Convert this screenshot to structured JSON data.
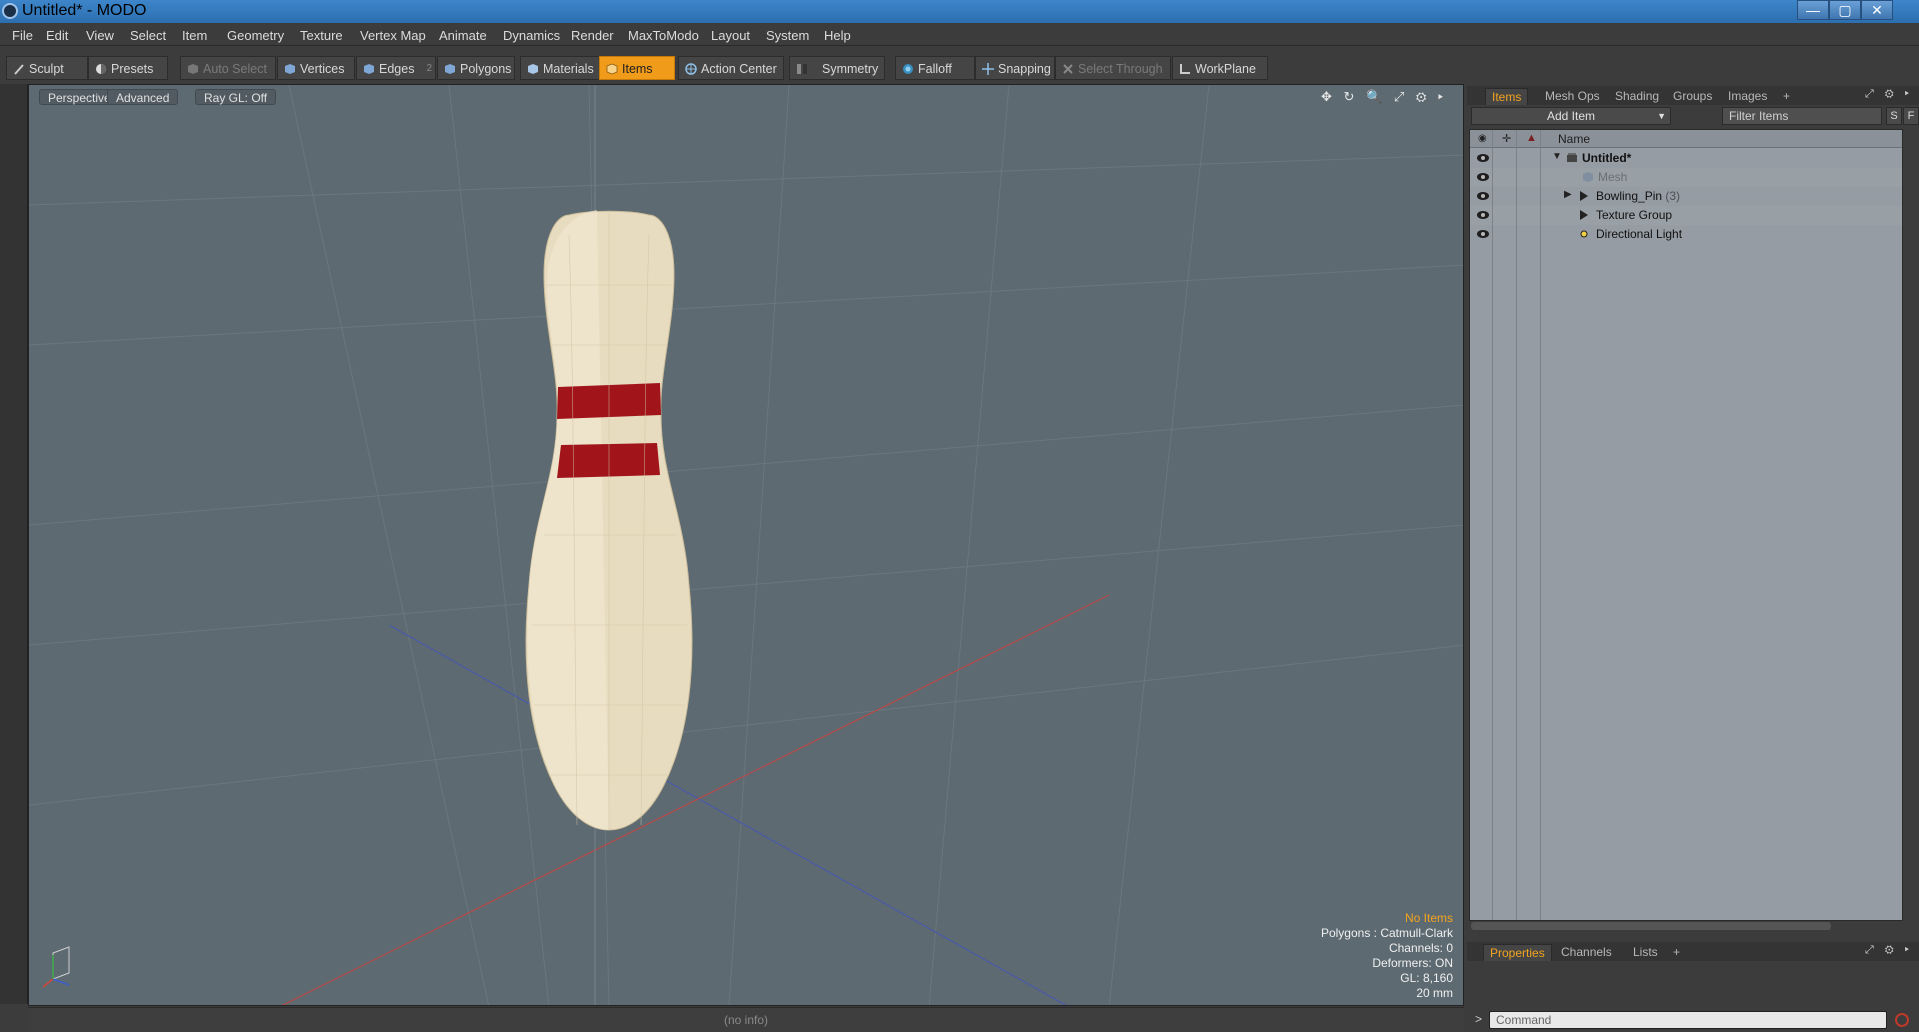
{
  "window": {
    "title": "Untitled* - MODO",
    "min_symbol": "—",
    "max_symbol": "▢",
    "close_symbol": "✕"
  },
  "menu": [
    "File",
    "Edit",
    "View",
    "Select",
    "Item",
    "Geometry",
    "Texture",
    "Vertex Map",
    "Animate",
    "Dynamics",
    "Render",
    "MaxToModo",
    "Layout",
    "System",
    "Help"
  ],
  "toolbar": {
    "sculpt": "Sculpt",
    "presets": "Presets",
    "auto_select": "Auto Select",
    "vertices": "Vertices",
    "edges": "Edges",
    "edges_count": "2",
    "polygons": "Polygons",
    "materials": "Materials",
    "items": "Items",
    "action_center": "Action Center",
    "symmetry": "Symmetry",
    "falloff": "Falloff",
    "snapping": "Snapping",
    "select_through": "Select Through",
    "workplane": "WorkPlane"
  },
  "viewport": {
    "view_mode": "Perspective",
    "shading": "Advanced",
    "raygl": "Ray GL: Off",
    "icons": "✥ ↻ 🔍 ⤢ ⚙ ▸",
    "info": {
      "selection": "No Items",
      "polygons": "Polygons : Catmull-Clark",
      "channels": "Channels: 0",
      "deformers": "Deformers: ON",
      "gl": "GL: 8,160",
      "scale": "20 mm"
    },
    "colors": {
      "background": "#5d6a71",
      "pin_body": "#e8dcc0",
      "pin_stripe": "#a0141a"
    }
  },
  "status": {
    "info": "(no info)"
  },
  "panel_top": {
    "tabs": [
      "Items",
      "Mesh Ops",
      "Shading",
      "Groups",
      "Images",
      "+"
    ],
    "add_item": "Add Item",
    "filter_placeholder": "Filter Items",
    "s_btn": "S",
    "f_btn": "F",
    "column_name": "Name",
    "tree": [
      {
        "label": "Untitled*",
        "bold": true
      },
      {
        "label": "Mesh",
        "dim": true
      },
      {
        "label": "Bowling_Pin",
        "count": "(3)"
      },
      {
        "label": "Texture Group"
      },
      {
        "label": "Directional Light"
      }
    ]
  },
  "panel_bottom": {
    "tabs": [
      "Properties",
      "Channels",
      "Lists",
      "+"
    ]
  },
  "command": {
    "prompt": ">",
    "placeholder": "Command"
  }
}
